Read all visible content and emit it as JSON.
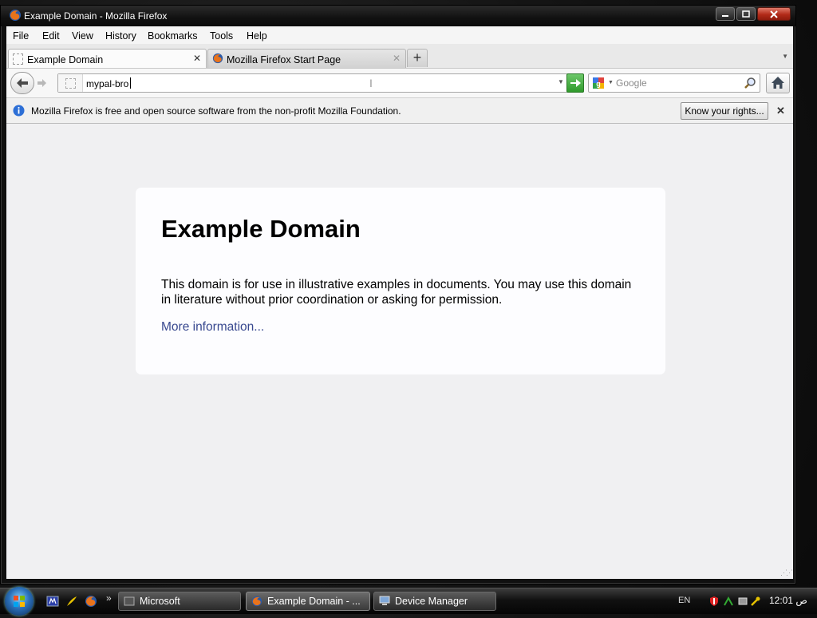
{
  "window": {
    "title": "Example Domain - Mozilla Firefox"
  },
  "menu": [
    "File",
    "Edit",
    "View",
    "History",
    "Bookmarks",
    "Tools",
    "Help"
  ],
  "tabs": [
    {
      "label": "Example Domain",
      "active": true
    },
    {
      "label": "Mozilla Firefox Start Page",
      "active": false
    }
  ],
  "navbar": {
    "url": "mypal-bro",
    "search_placeholder": "Google"
  },
  "notification": {
    "message": "Mozilla Firefox is free and open source software from the non-profit Mozilla Foundation.",
    "button": "Know your rights..."
  },
  "page": {
    "heading": "Example Domain",
    "paragraph": "This domain is for use in illustrative examples in documents. You may use this domain in literature without prior coordination or asking for permission.",
    "link": "More information..."
  },
  "taskbar": {
    "tasks": [
      "Microsoft",
      "Example Domain - ...",
      "Device Manager"
    ],
    "language": "EN",
    "clock": "12:01 ص"
  }
}
